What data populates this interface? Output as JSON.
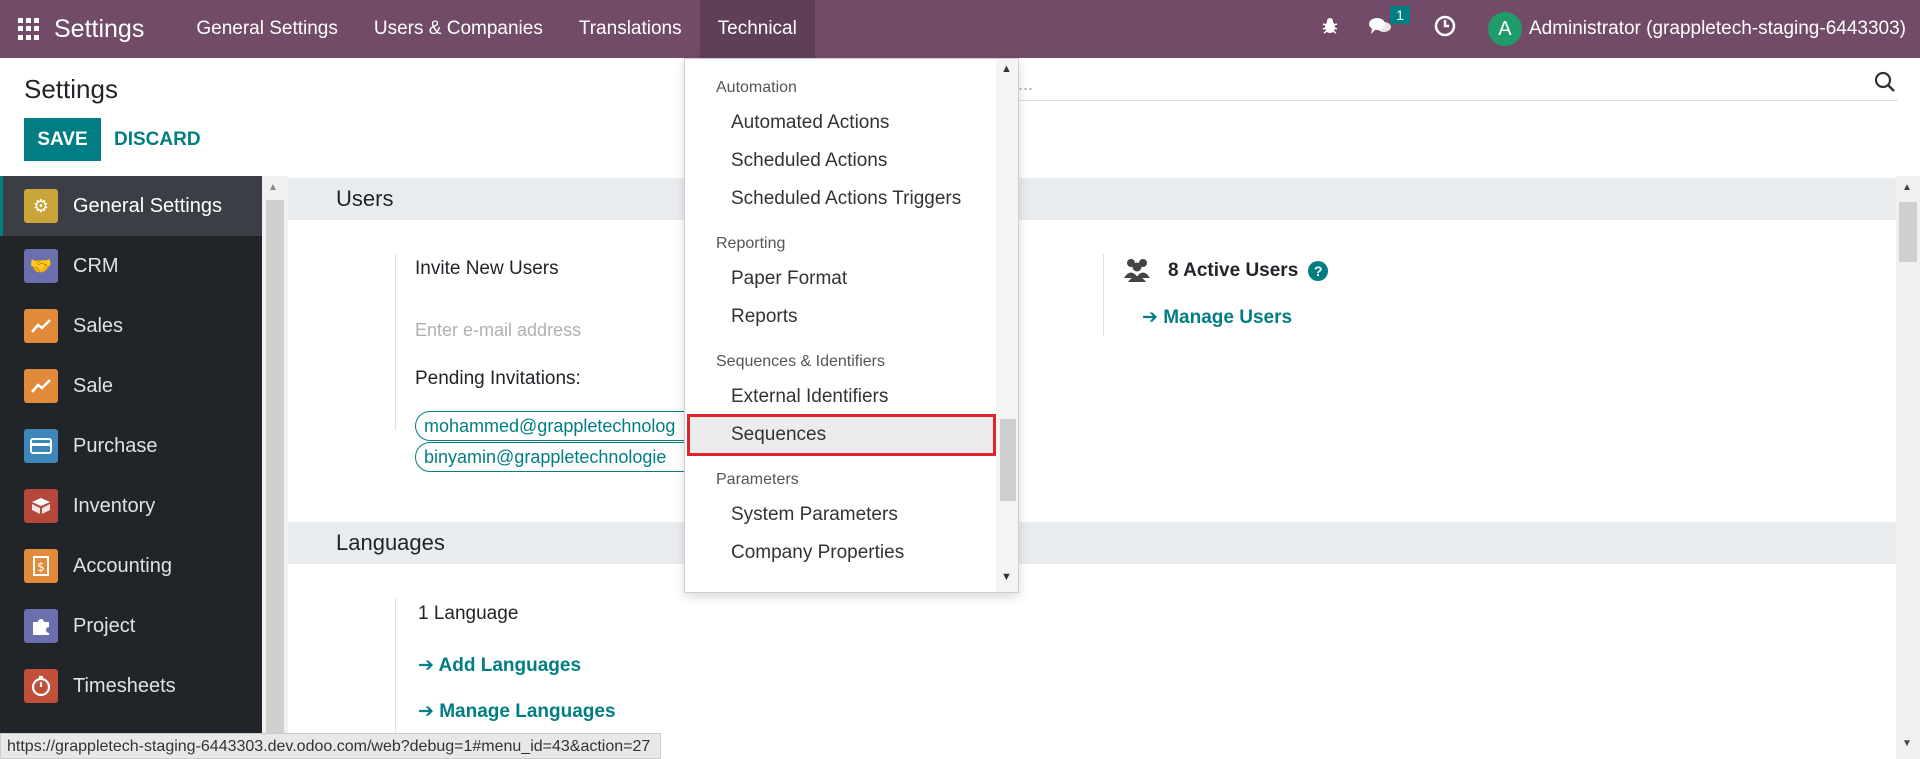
{
  "navbar": {
    "brand": "Settings",
    "menus": [
      "General Settings",
      "Users & Companies",
      "Translations",
      "Technical"
    ],
    "messages_count": "1",
    "avatar_letter": "A",
    "user_label": "Administrator (grappletech-staging-6443303)"
  },
  "control_panel": {
    "breadcrumb": "Settings",
    "save_label": "SAVE",
    "discard_label": "DISCARD",
    "search_placeholder": "..."
  },
  "sidebar": {
    "items": [
      {
        "label": "General Settings",
        "icon": "gear-icon",
        "color": "#c9a53a"
      },
      {
        "label": "CRM",
        "icon": "handshake-icon",
        "color": "#6b6fae"
      },
      {
        "label": "Sales",
        "icon": "chart-icon",
        "color": "#e28a3b"
      },
      {
        "label": "Sale",
        "icon": "chart-icon",
        "color": "#e28a3b"
      },
      {
        "label": "Purchase",
        "icon": "card-icon",
        "color": "#3e86b8"
      },
      {
        "label": "Inventory",
        "icon": "box-icon",
        "color": "#b5473b"
      },
      {
        "label": "Accounting",
        "icon": "invoice-icon",
        "color": "#e28a3b"
      },
      {
        "label": "Project",
        "icon": "puzzle-icon",
        "color": "#6b6fae"
      },
      {
        "label": "Timesheets",
        "icon": "stopwatch-icon",
        "color": "#c0503a"
      }
    ]
  },
  "users_section": {
    "title": "Users",
    "invite_label": "Invite New Users",
    "email_placeholder": "Enter e-mail address",
    "pending_label": "Pending Invitations:",
    "pending": [
      "mohammed@grappletechnolog",
      "binyamin@grappletechnologie"
    ],
    "active_users": "8 Active Users",
    "manage_users": "Manage Users"
  },
  "languages_section": {
    "title": "Languages",
    "count": "1 Language",
    "add": "Add Languages",
    "manage": "Manage Languages"
  },
  "technical_menu": {
    "groups": [
      {
        "header": "Automation",
        "items": [
          "Automated Actions",
          "Scheduled Actions",
          "Scheduled Actions Triggers"
        ]
      },
      {
        "header": "Reporting",
        "items": [
          "Paper Format",
          "Reports"
        ]
      },
      {
        "header": "Sequences & Identifiers",
        "items": [
          "External Identifiers",
          "Sequences"
        ]
      },
      {
        "header": "Parameters",
        "items": [
          "System Parameters",
          "Company Properties"
        ]
      }
    ],
    "highlighted": "Sequences"
  },
  "status_url": "https://grappletech-staging-6443303.dev.odoo.com/web?debug=1#menu_id=43&action=27",
  "colors": {
    "brand": "#714b67",
    "accent": "#017e84",
    "highlight": "#e0242e"
  }
}
